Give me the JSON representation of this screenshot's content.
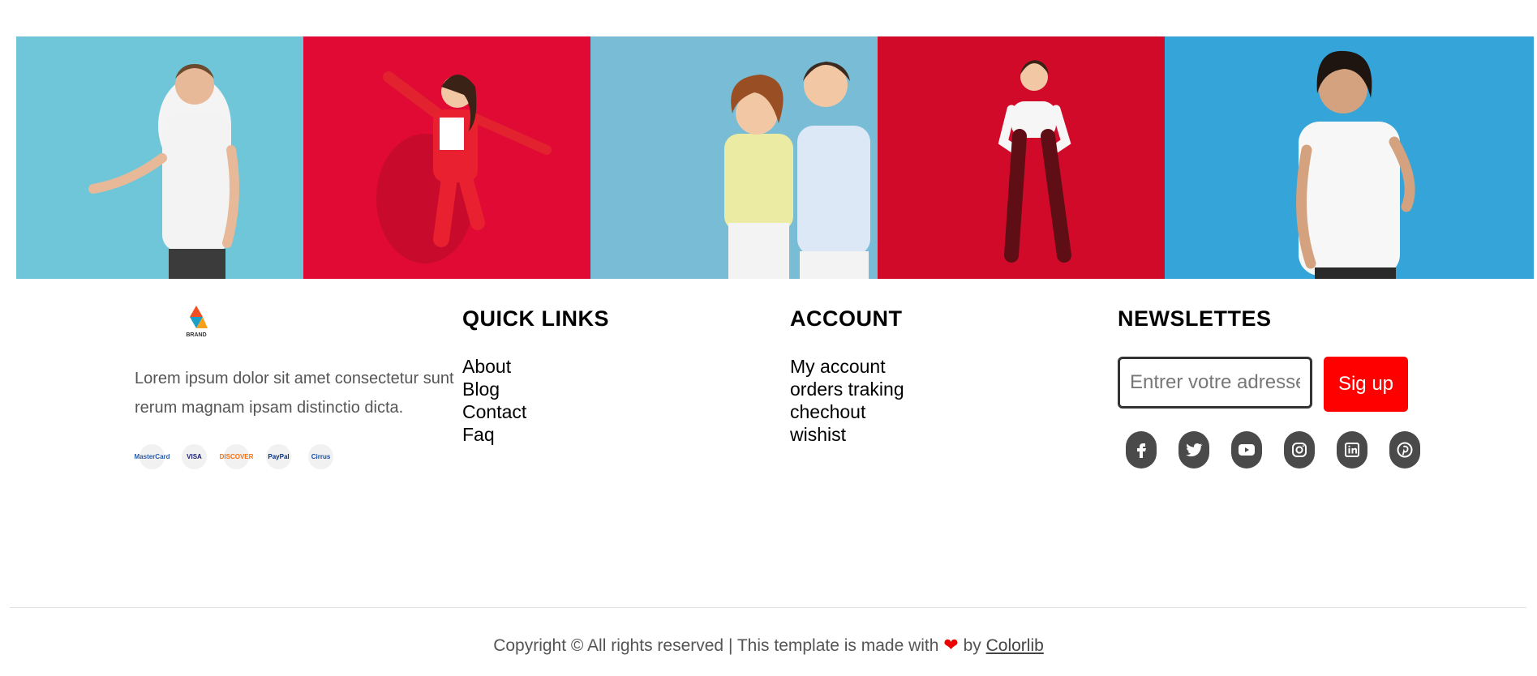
{
  "gallery": [
    {
      "bg": "#6ec6d8"
    },
    {
      "bg": "#e00a34"
    },
    {
      "bg": "#78bcd6"
    },
    {
      "bg": "#d20a2a"
    },
    {
      "bg": "#35a4d8"
    }
  ],
  "brand": {
    "logo_text": "BRAND",
    "description": "Lorem ipsum dolor sit amet consectetur sunt rerum magnam ipsam distinctio dicta."
  },
  "payments": [
    {
      "name": "mastercard-icon",
      "label": "MasterCard",
      "color": "#2b5ca8"
    },
    {
      "name": "visa-icon",
      "label": "VISA",
      "color": "#1a1f71"
    },
    {
      "name": "discover-icon",
      "label": "DISCOVER",
      "color": "#f47216"
    },
    {
      "name": "paypal-icon",
      "label": "PayPal",
      "color": "#003087"
    },
    {
      "name": "cirrus-icon",
      "label": "Cirrus",
      "color": "#1b4fa0"
    }
  ],
  "quick_links": {
    "title": "QUICK LINKS",
    "items": [
      "About",
      "Blog",
      "Contact",
      "Faq"
    ]
  },
  "account": {
    "title": "ACCOUNT",
    "items": [
      "My account",
      "orders traking",
      "chechout",
      "wishist"
    ]
  },
  "newsletter": {
    "title": "NEWSLETTES",
    "placeholder": "Entrer votre adresse",
    "button_label": "Sig up",
    "button_color": "#ff0000"
  },
  "socials": [
    "facebook-icon",
    "twitter-icon",
    "youtube-icon",
    "instagram-icon",
    "linkedin-icon",
    "pinterest-icon"
  ],
  "footer": {
    "copyright_prefix": "Copyright © All rights reserved | This template is made with",
    "by": "by",
    "link": "Colorlib"
  }
}
